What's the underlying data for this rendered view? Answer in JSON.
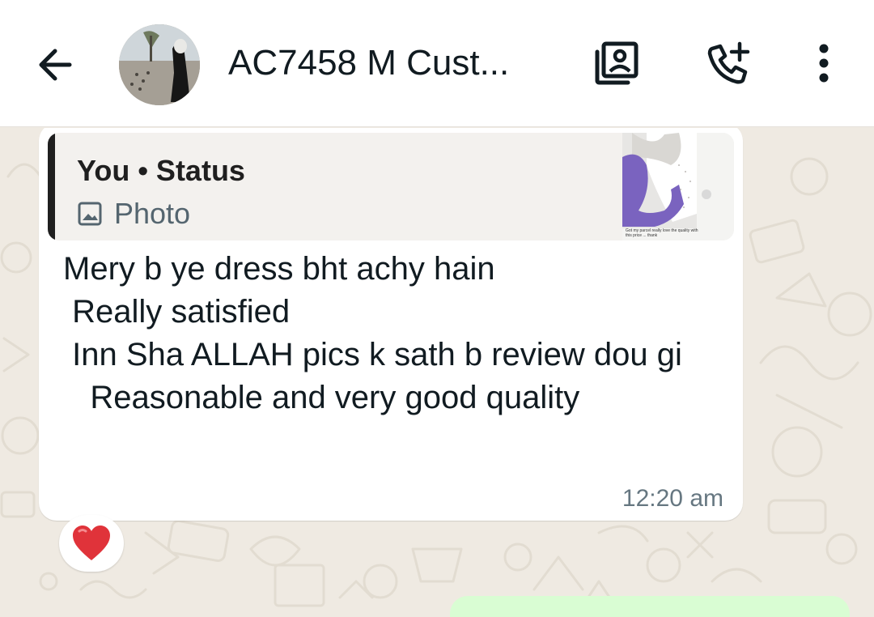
{
  "header": {
    "back_icon": "arrow-left-icon",
    "title": "AC7458 M Cust...",
    "gallery_icon": "contact-card-icon",
    "call_icon": "add-call-icon",
    "more_icon": "more-vertical-icon"
  },
  "message": {
    "quote": {
      "sender": "You • Status",
      "type_icon": "photo-icon",
      "type_label": "Photo",
      "thumb_caption": "Got my parcel really love the quality with this price ... thank"
    },
    "text": "Mery b ye dress bht achy hain\n Really satisfied\n Inn Sha ALLAH pics k sath b review dou gi\n   Reasonable and very good quality",
    "time": "12:20 am",
    "reaction": "❤️"
  },
  "colors": {
    "header_bg": "#ffffff",
    "chat_bg": "#efeae2",
    "incoming_bubble": "#ffffff",
    "outgoing_bubble": "#d9fdd3",
    "quote_bar": "#1f1f1f",
    "reaction_heart": "#e0333a"
  }
}
